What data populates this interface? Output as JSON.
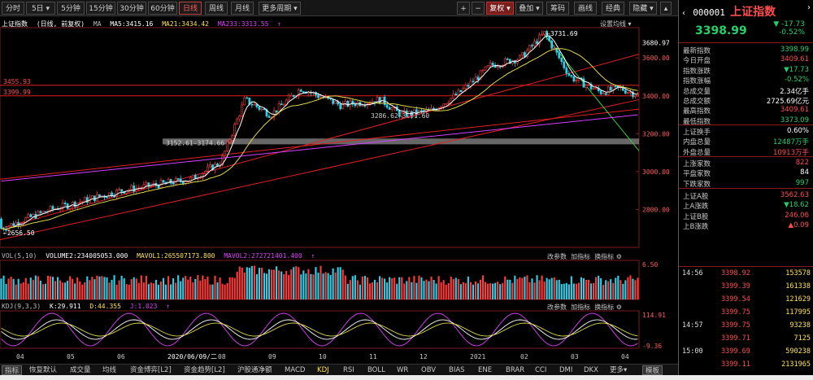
{
  "toolbar": {
    "left": [
      "分时",
      "5日",
      "5分钟",
      "15分钟",
      "30分钟",
      "60分钟",
      "日线",
      "周线",
      "月线",
      "更多周期"
    ],
    "right": [
      "+",
      "−",
      "复权",
      "叠加",
      "筹码",
      "画线",
      "经典",
      "隐藏"
    ],
    "active_period": "日线"
  },
  "chart": {
    "title": "上证指数",
    "mode": "(日线, 前复权)",
    "ma_label": "MA",
    "ma5": "MA5:3415.16",
    "ma21": "MA21:3434.42",
    "ma233": "MA233:3313.55",
    "settings_label": "设置均线",
    "price_axis": [
      "3600.00",
      "3400.00",
      "3200.00",
      "3000.00",
      "2800.00"
    ],
    "price_top_label": "3680.97",
    "level_3455": "3455.93",
    "level_3399": "3399.99",
    "high_label": "3731.69",
    "low_label": "2656.50",
    "box_label": "3152.61-3174.66",
    "range_label": "3286.62-3291.60",
    "dates": [
      "04",
      "05",
      "06",
      "2020/06/09/二",
      "08",
      "09",
      "10",
      "11",
      "12",
      "2021",
      "02",
      "03",
      "04"
    ],
    "colors": {
      "up": "#ff3b3b",
      "down": "#2fd0e8",
      "ma5": "#ffffff",
      "ma21": "#e0d64a",
      "ma233": "#d440ff",
      "trend_red": "#e02020",
      "trend_green": "#3ad23a"
    }
  },
  "vol": {
    "label": "VOL(5,10)",
    "volume": "VOLUME2:234005053.000",
    "mavol1": "MAVOL1:265507173.800",
    "mavol2": "MAVOL2:272721401.400",
    "tools": [
      "改参数",
      "加指标",
      "换指标"
    ],
    "axis_top": "6.50"
  },
  "kdj": {
    "label": "KDJ(9,3,3)",
    "k": "K:29.911",
    "d": "D:44.355",
    "j": "J:1.023",
    "tools": [
      "改参数",
      "加指标",
      "换指标"
    ],
    "axis_top": "114.91",
    "axis_bottom": "-9.36"
  },
  "tabs": [
    "指标",
    "恢复默认",
    "成交量",
    "均线",
    "资金博弈[L2]",
    "资金趋势[L2]",
    "沪股通净额",
    "MACD",
    "KDJ",
    "RSI",
    "BOLL",
    "WR",
    "OBV",
    "BIAS",
    "ENE",
    "BRAR",
    "CCI",
    "DMI",
    "DKX",
    "更多"
  ],
  "tab_template": "模板",
  "panel": {
    "code": "000001",
    "name": "上证指数",
    "price": "3398.99",
    "change": "-17.73",
    "change_pct": "-0.52%",
    "rows": [
      {
        "label": "最新指数",
        "value": "3398.99",
        "color": "green"
      },
      {
        "label": "今日开盘",
        "value": "3409.61",
        "color": "red"
      },
      {
        "label": "指数涨跌",
        "value": "▼17.73",
        "color": "green"
      },
      {
        "label": "指数涨幅",
        "value": "-0.52%",
        "color": "green"
      },
      {
        "label": "总成交量",
        "value": "2.34亿手",
        "color": "white"
      },
      {
        "label": "总成交额",
        "value": "2725.69亿元",
        "color": "white"
      },
      {
        "label": "最高指数",
        "value": "3409.61",
        "color": "red"
      },
      {
        "label": "最低指数",
        "value": "3373.09",
        "color": "green"
      }
    ],
    "rows2": [
      {
        "label": "上证换手",
        "value": "0.60%",
        "color": "white"
      },
      {
        "label": "内盘总量",
        "value": "12487万手",
        "color": "green"
      },
      {
        "label": "外盘总量",
        "value": "10913万手",
        "color": "red"
      }
    ],
    "rows3": [
      {
        "label": "上涨家数",
        "value": "822",
        "color": "red"
      },
      {
        "label": "平盘家数",
        "value": "84",
        "color": "white"
      },
      {
        "label": "下跌家数",
        "value": "997",
        "color": "green"
      }
    ],
    "rows4": [
      {
        "label": "上证A股",
        "value": "3562.63",
        "color": "red"
      },
      {
        "label": "上A涨跌",
        "value": "▼18.62",
        "color": "green"
      },
      {
        "label": "上证B股",
        "value": "246.06",
        "color": "red"
      },
      {
        "label": "上B涨跌",
        "value": "▲0.09",
        "color": "red"
      }
    ],
    "ticks": [
      {
        "time": "14:56",
        "price": "3398.92",
        "vol": "153578"
      },
      {
        "time": "",
        "price": "3399.39",
        "vol": "161338"
      },
      {
        "time": "",
        "price": "3399.54",
        "vol": "121629"
      },
      {
        "time": "",
        "price": "3399.75",
        "vol": "117995"
      },
      {
        "time": "14:57",
        "price": "3399.75",
        "vol": "93238"
      },
      {
        "time": "",
        "price": "3399.71",
        "vol": "7125"
      },
      {
        "time": "15:00",
        "price": "3399.69",
        "vol": "590238"
      },
      {
        "time": "",
        "price": "3399.11",
        "vol": "2131965"
      }
    ]
  }
}
